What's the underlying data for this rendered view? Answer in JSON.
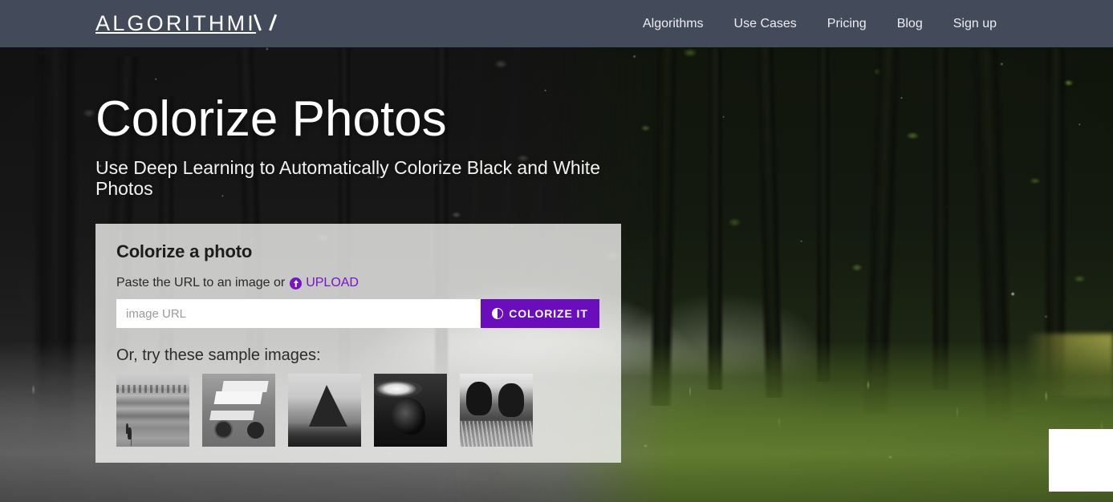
{
  "header": {
    "logo_text": "ALGORITHMI",
    "logo_full": "ALGORITHMIA",
    "nav": [
      {
        "label": "Algorithms",
        "name": "nav-algorithms"
      },
      {
        "label": "Use Cases",
        "name": "nav-use-cases"
      },
      {
        "label": "Pricing",
        "name": "nav-pricing"
      },
      {
        "label": "Blog",
        "name": "nav-blog"
      },
      {
        "label": "Sign up",
        "name": "nav-sign-up"
      }
    ],
    "background_color": "#434a59"
  },
  "hero": {
    "title": "Colorize Photos",
    "subtitle": "Use Deep Learning to Automatically Colorize Black and White Photos"
  },
  "card": {
    "title": "Colorize a photo",
    "prompt_text": "Paste the URL to an image or",
    "upload_label": "UPLOAD",
    "upload_icon": "upload-circle-icon",
    "input_value": "",
    "input_placeholder": "image URL",
    "submit_label": "COLORIZE IT",
    "submit_icon": "contrast-icon",
    "samples_label": "Or, try these sample images:",
    "accent_color": "#6a0dbd",
    "link_color": "#7814c8",
    "samples": [
      {
        "name": "sample-thumb-bird",
        "alt": "black and white photo of a shorebird standing in shallow water"
      },
      {
        "name": "sample-thumb-race-car",
        "alt": "black and white photo of a sprint race car"
      },
      {
        "name": "sample-thumb-mountain",
        "alt": "black and white photo of a rocky mountain peak"
      },
      {
        "name": "sample-thumb-splash",
        "alt": "black and white photo of a dark figure with water splash"
      },
      {
        "name": "sample-thumb-cows",
        "alt": "black and white photo of two cows in tall grass"
      }
    ]
  },
  "background": {
    "description": "forest of tall trees with grassy path, left half desaturated to black and white, right half in full color",
    "grayscale_side": "left",
    "color_side": "right"
  },
  "chat_widget": {
    "name": "chat-widget-placeholder",
    "label": ""
  }
}
